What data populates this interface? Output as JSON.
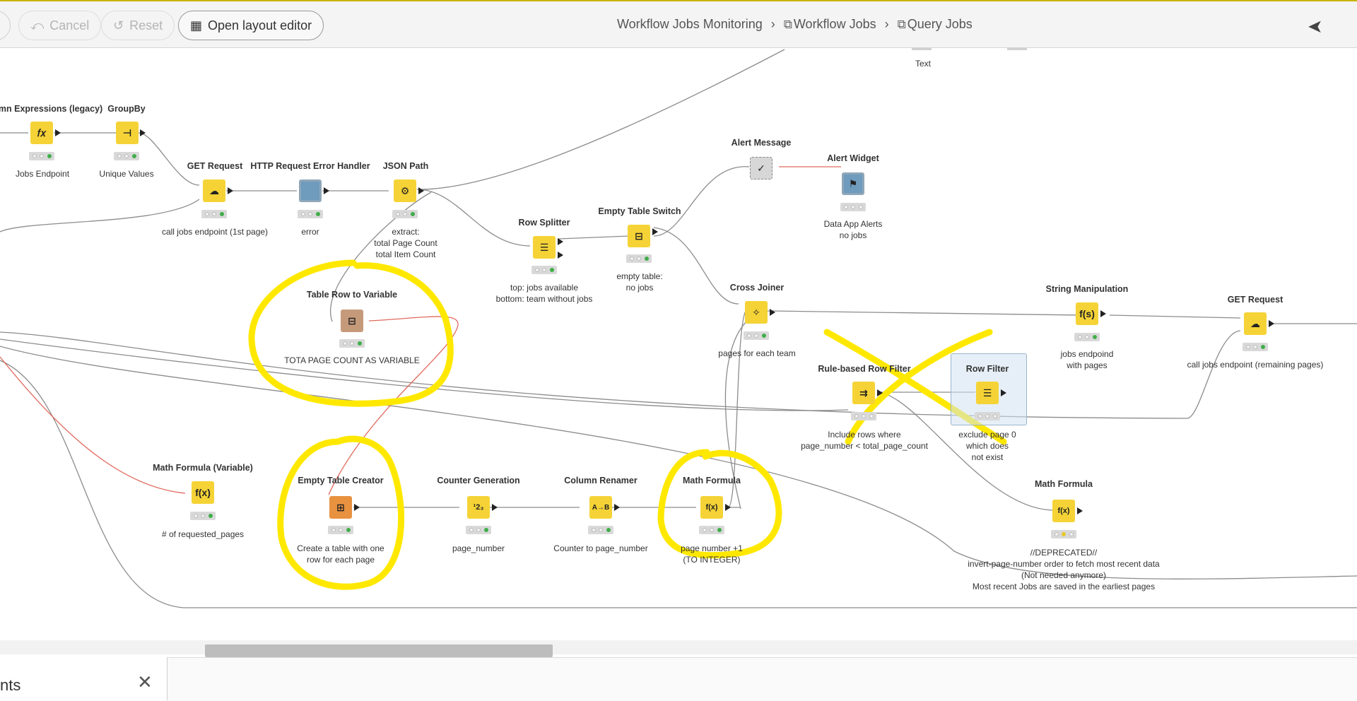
{
  "toolbar": {
    "cancel_label": "Cancel",
    "reset_label": "Reset",
    "layout_editor_label": "Open layout editor"
  },
  "breadcrumb": {
    "item1": "Workflow Jobs Monitoring",
    "item2": "Workflow Jobs",
    "item3": "Query Jobs"
  },
  "nodes": {
    "column_expressions": {
      "title": "lumn Expressions (legacy)",
      "label": "Jobs Endpoint"
    },
    "groupby": {
      "title": "GroupBy",
      "label": "Unique Values"
    },
    "get_request_1": {
      "title": "GET Request",
      "label": "call jobs endpoint (1st page)"
    },
    "http_error_handler": {
      "title": "HTTP Request Error Handler",
      "label": "error"
    },
    "json_path": {
      "title": "JSON Path",
      "label_l1": "extract:",
      "label_l2": "total Page Count",
      "label_l3": "total Item Count"
    },
    "table_row_to_variable": {
      "title": "Table Row to Variable",
      "label": "TOTA PAGE COUNT AS VARIABLE"
    },
    "row_splitter": {
      "title": "Row Splitter",
      "label_l1": "top: jobs available",
      "label_l2": "bottom: team without jobs"
    },
    "empty_table_switch": {
      "title": "Empty Table Switch",
      "label_l1": "empty table:",
      "label_l2": "no jobs"
    },
    "alert_message": {
      "title": "Alert Message"
    },
    "alert_widget": {
      "title": "Alert Widget",
      "label_l1": "Data App Alerts",
      "label_l2": "no jobs"
    },
    "cross_joiner": {
      "title": "Cross Joiner",
      "label": "pages for each team"
    },
    "rule_row_filter": {
      "title": "Rule-based Row Filter",
      "label_l1": "Include rows where",
      "label_l2": "page_number < total_page_count"
    },
    "row_filter": {
      "title": "Row Filter",
      "label_l1": "exclude page 0",
      "label_l2": "which does",
      "label_l3": "not exist"
    },
    "string_manipulation": {
      "title": "String Manipulation",
      "label_l1": "jobs endpoind",
      "label_l2": "with pages"
    },
    "get_request_2": {
      "title": "GET Request",
      "label": "call jobs endpoint (remaining pages)"
    },
    "math_formula_variable": {
      "title": "Math Formula (Variable)",
      "label": "# of requested_pages"
    },
    "empty_table_creator": {
      "title": "Empty Table Creator",
      "label_l1": "Create a table with one",
      "label_l2": "row for each page"
    },
    "counter_generation": {
      "title": "Counter Generation",
      "label": "page_number"
    },
    "column_renamer": {
      "title": "Column Renamer",
      "label": "Counter to page_number"
    },
    "math_formula_1": {
      "title": "Math Formula",
      "label_l1": "page number +1",
      "label_l2": "(TO INTEGER)"
    },
    "math_formula_2": {
      "title": "Math Formula",
      "label_l1": "//DEPRECATED//",
      "label_l2": "invert-page-number order to fetch most recent data",
      "label_l3": "(Not needed anymore)",
      "label_l4": "Most recent Jobs are saved in the earliest pages"
    },
    "text_annotation": {
      "label": "Text"
    }
  },
  "icons": {
    "column_expressions": "𝑓𝑥",
    "groupby": "⊣",
    "get_request": "☁",
    "http_error_handler": "■",
    "json_path": "⚙",
    "table_row_to_variable": "⊟",
    "row_splitter": "☰",
    "empty_table_switch": "⊟",
    "alert_message": "✓",
    "alert_widget": "⚑",
    "cross_joiner": "✧",
    "row_filter": "☰",
    "string_manipulation": "f(s)",
    "math_formula": "f(x)",
    "empty_table_creator": "⊞",
    "counter_generation": "¹2₃",
    "column_renamer": "A→B"
  },
  "colors": {
    "node_yellow": "#f5d336",
    "node_orange": "#e8913f",
    "node_brown": "#c59a7b",
    "node_blue": "#6f9bbd",
    "highlight_annotation": "#ffe800",
    "variable_wire": "#e06a5e"
  },
  "bottom_panel": {
    "tab_label": "nts"
  }
}
